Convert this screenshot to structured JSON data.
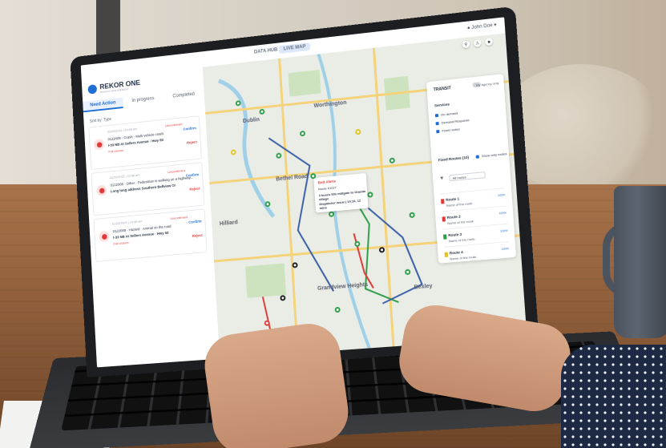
{
  "app": {
    "top_tabs": [
      "DATA HUB",
      "LIVE MAP"
    ],
    "user_name": "John Doe",
    "logo": {
      "name": "REKOR ONE",
      "sub": "TRAFFIC MANAGEMENT"
    }
  },
  "left_panel": {
    "tabs": [
      "Need Action",
      "In progress",
      "Completed"
    ],
    "active_tab": "Need Action",
    "sort_label": "Sort by:",
    "sort_value": "Type",
    "incidents": [
      {
        "meta": "01/22/2021 | 10:56 am",
        "id": "0122008",
        "type": "Crash",
        "desc": "Multi vehicle crash",
        "address": "I-33 NB At Sellers Avenue",
        "lane": "Hwy 50",
        "status": "Full closure",
        "badge": "Unconfirmed",
        "confirm": "Confirm",
        "reject": "Reject"
      },
      {
        "meta": "01/22/2021 | 10:56 am",
        "id": "0122008",
        "type": "Other",
        "desc": "Pedestrian is walking on a highway...",
        "address": "Long long address Southern Bellview OB At Rez Hunt Hi...",
        "lane": "",
        "status": "",
        "badge": "Unconfirmed",
        "confirm": "Confirm",
        "reject": "Reject"
      },
      {
        "meta": "01/22/2021 | 10:56 am",
        "id": "0122008",
        "type": "Hazard",
        "desc": "Animal on the road",
        "address": "I-33 NB At Sellers Avenue",
        "lane": "Hwy 50",
        "status": "Full closure",
        "badge": "Unconfirmed",
        "confirm": "Confirm",
        "reject": "Reject"
      }
    ]
  },
  "map": {
    "labels": [
      "Dublin",
      "Worthington",
      "Bethel Road",
      "Grandview Heights",
      "Bexley",
      "Hilliard"
    ],
    "popup": {
      "title": "Bolt Alerts",
      "sub": "Route #1027",
      "line1": "3 buses 60s mitigate to Granite village",
      "line2": "Dispatcher issue | 10:16, 12 mins"
    }
  },
  "right_panel": {
    "title": "TRANSIT",
    "toggle_label": "My agency only",
    "services_title": "Services",
    "services": [
      "On demand",
      "Demand Response",
      "Fixed routes"
    ],
    "fixed_routes_title": "Fixed Routes (10)",
    "show_only_label": "Show only routes",
    "select_value": "All routes",
    "routes": [
      {
        "name": "Route 1",
        "sub": "Name of the route",
        "badge": "100%",
        "color": "#e03b3b"
      },
      {
        "name": "Route 2",
        "sub": "Name of the route",
        "badge": "100%",
        "color": "#e03b3b"
      },
      {
        "name": "Route 3",
        "sub": "Name of the route",
        "badge": "100%",
        "color": "#2e9e4a"
      },
      {
        "name": "Route 4",
        "sub": "Name of the route",
        "badge": "100%",
        "color": "#e7c21c"
      }
    ]
  },
  "colors": {
    "accent": "#1f6ed4",
    "alert": "#e03b3b",
    "route_green": "#2e9e4a",
    "route_red": "#e03b3b",
    "route_blue": "#3b5fa8"
  }
}
